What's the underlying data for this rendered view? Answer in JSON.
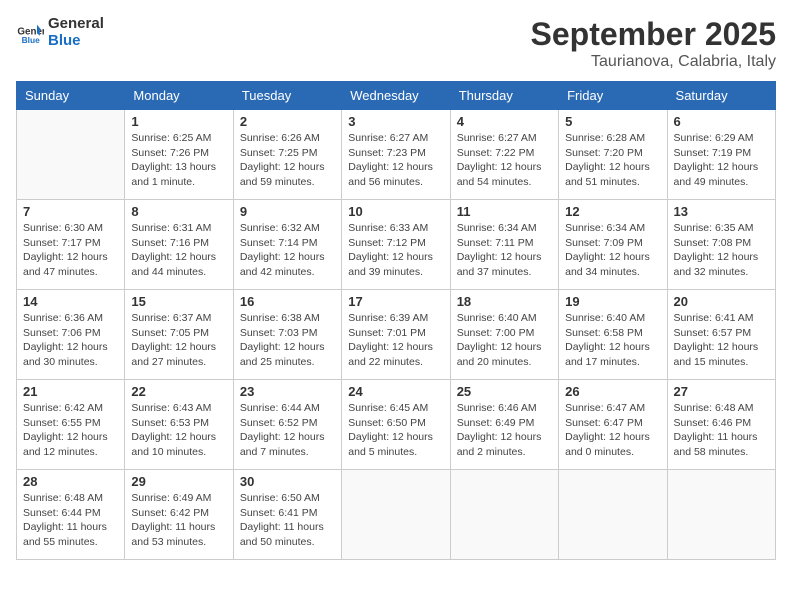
{
  "logo": {
    "line1": "General",
    "line2": "Blue"
  },
  "title": "September 2025",
  "subtitle": "Taurianova, Calabria, Italy",
  "days_of_week": [
    "Sunday",
    "Monday",
    "Tuesday",
    "Wednesday",
    "Thursday",
    "Friday",
    "Saturday"
  ],
  "weeks": [
    [
      {
        "day": "",
        "info": ""
      },
      {
        "day": "1",
        "info": "Sunrise: 6:25 AM\nSunset: 7:26 PM\nDaylight: 13 hours\nand 1 minute."
      },
      {
        "day": "2",
        "info": "Sunrise: 6:26 AM\nSunset: 7:25 PM\nDaylight: 12 hours\nand 59 minutes."
      },
      {
        "day": "3",
        "info": "Sunrise: 6:27 AM\nSunset: 7:23 PM\nDaylight: 12 hours\nand 56 minutes."
      },
      {
        "day": "4",
        "info": "Sunrise: 6:27 AM\nSunset: 7:22 PM\nDaylight: 12 hours\nand 54 minutes."
      },
      {
        "day": "5",
        "info": "Sunrise: 6:28 AM\nSunset: 7:20 PM\nDaylight: 12 hours\nand 51 minutes."
      },
      {
        "day": "6",
        "info": "Sunrise: 6:29 AM\nSunset: 7:19 PM\nDaylight: 12 hours\nand 49 minutes."
      }
    ],
    [
      {
        "day": "7",
        "info": "Sunrise: 6:30 AM\nSunset: 7:17 PM\nDaylight: 12 hours\nand 47 minutes."
      },
      {
        "day": "8",
        "info": "Sunrise: 6:31 AM\nSunset: 7:16 PM\nDaylight: 12 hours\nand 44 minutes."
      },
      {
        "day": "9",
        "info": "Sunrise: 6:32 AM\nSunset: 7:14 PM\nDaylight: 12 hours\nand 42 minutes."
      },
      {
        "day": "10",
        "info": "Sunrise: 6:33 AM\nSunset: 7:12 PM\nDaylight: 12 hours\nand 39 minutes."
      },
      {
        "day": "11",
        "info": "Sunrise: 6:34 AM\nSunset: 7:11 PM\nDaylight: 12 hours\nand 37 minutes."
      },
      {
        "day": "12",
        "info": "Sunrise: 6:34 AM\nSunset: 7:09 PM\nDaylight: 12 hours\nand 34 minutes."
      },
      {
        "day": "13",
        "info": "Sunrise: 6:35 AM\nSunset: 7:08 PM\nDaylight: 12 hours\nand 32 minutes."
      }
    ],
    [
      {
        "day": "14",
        "info": "Sunrise: 6:36 AM\nSunset: 7:06 PM\nDaylight: 12 hours\nand 30 minutes."
      },
      {
        "day": "15",
        "info": "Sunrise: 6:37 AM\nSunset: 7:05 PM\nDaylight: 12 hours\nand 27 minutes."
      },
      {
        "day": "16",
        "info": "Sunrise: 6:38 AM\nSunset: 7:03 PM\nDaylight: 12 hours\nand 25 minutes."
      },
      {
        "day": "17",
        "info": "Sunrise: 6:39 AM\nSunset: 7:01 PM\nDaylight: 12 hours\nand 22 minutes."
      },
      {
        "day": "18",
        "info": "Sunrise: 6:40 AM\nSunset: 7:00 PM\nDaylight: 12 hours\nand 20 minutes."
      },
      {
        "day": "19",
        "info": "Sunrise: 6:40 AM\nSunset: 6:58 PM\nDaylight: 12 hours\nand 17 minutes."
      },
      {
        "day": "20",
        "info": "Sunrise: 6:41 AM\nSunset: 6:57 PM\nDaylight: 12 hours\nand 15 minutes."
      }
    ],
    [
      {
        "day": "21",
        "info": "Sunrise: 6:42 AM\nSunset: 6:55 PM\nDaylight: 12 hours\nand 12 minutes."
      },
      {
        "day": "22",
        "info": "Sunrise: 6:43 AM\nSunset: 6:53 PM\nDaylight: 12 hours\nand 10 minutes."
      },
      {
        "day": "23",
        "info": "Sunrise: 6:44 AM\nSunset: 6:52 PM\nDaylight: 12 hours\nand 7 minutes."
      },
      {
        "day": "24",
        "info": "Sunrise: 6:45 AM\nSunset: 6:50 PM\nDaylight: 12 hours\nand 5 minutes."
      },
      {
        "day": "25",
        "info": "Sunrise: 6:46 AM\nSunset: 6:49 PM\nDaylight: 12 hours\nand 2 minutes."
      },
      {
        "day": "26",
        "info": "Sunrise: 6:47 AM\nSunset: 6:47 PM\nDaylight: 12 hours\nand 0 minutes."
      },
      {
        "day": "27",
        "info": "Sunrise: 6:48 AM\nSunset: 6:46 PM\nDaylight: 11 hours\nand 58 minutes."
      }
    ],
    [
      {
        "day": "28",
        "info": "Sunrise: 6:48 AM\nSunset: 6:44 PM\nDaylight: 11 hours\nand 55 minutes."
      },
      {
        "day": "29",
        "info": "Sunrise: 6:49 AM\nSunset: 6:42 PM\nDaylight: 11 hours\nand 53 minutes."
      },
      {
        "day": "30",
        "info": "Sunrise: 6:50 AM\nSunset: 6:41 PM\nDaylight: 11 hours\nand 50 minutes."
      },
      {
        "day": "",
        "info": ""
      },
      {
        "day": "",
        "info": ""
      },
      {
        "day": "",
        "info": ""
      },
      {
        "day": "",
        "info": ""
      }
    ]
  ]
}
